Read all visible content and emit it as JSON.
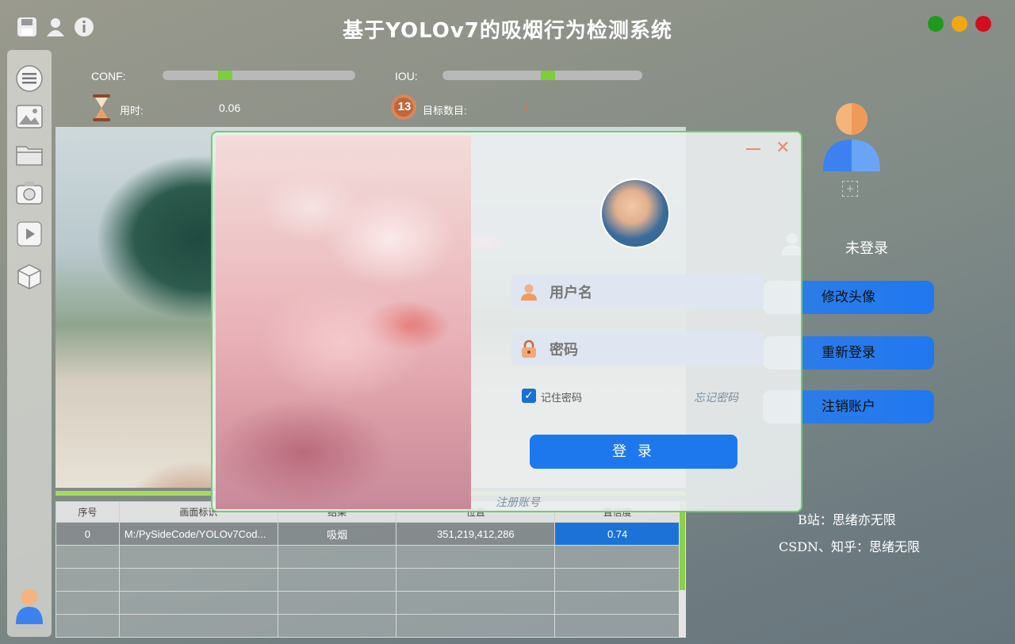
{
  "app": {
    "title": "基于YOLOv7的吸烟行为检测系统",
    "toolbar_icons": [
      "save-icon",
      "user-icon",
      "info-icon"
    ],
    "window_controls": {
      "close_color": "#d0021b",
      "minimize_color": "#f5a623",
      "maximize_color": "#2ea52a"
    }
  },
  "sidebar": {
    "icons": [
      "menu-icon",
      "image-icon",
      "folder-icon",
      "camera-icon",
      "video-icon",
      "model-icon"
    ],
    "bottom_icon": "user-avatar-icon"
  },
  "params": {
    "conf_label": "CONF:",
    "iou_label": "IOU:",
    "conf_level": 0.31,
    "iou_level": 0.53,
    "time_label": "用时:",
    "time_value": "0.06",
    "count_label": "目标数目:",
    "count_value": "1",
    "count_icon_text": "13"
  },
  "image": {
    "badge": "4%"
  },
  "table": {
    "headers": [
      "序号",
      "画面标识",
      "结果",
      "位置",
      "置信度"
    ],
    "rows": [
      [
        "0",
        "M:/PySideCode/YOLOv7Cod...",
        "吸烟",
        "351,219,412,286",
        "0.74"
      ]
    ]
  },
  "right_panel": {
    "add_symbol": "+",
    "status": "未登录",
    "buttons": {
      "change_avatar": "修改头像",
      "relogin": "重新登录",
      "delete_account": "注销账户"
    },
    "credit_bilibili": "B站：思绪亦无限",
    "credit_csdn": "CSDN、知乎：思绪无限"
  },
  "login": {
    "username_placeholder": "用户名",
    "password_placeholder": "密码",
    "remember": "记住密码",
    "remember_checked": true,
    "forgot": "忘记密码",
    "login_button": "登 录",
    "register": "注册账号",
    "accent": "#1d78ee"
  }
}
